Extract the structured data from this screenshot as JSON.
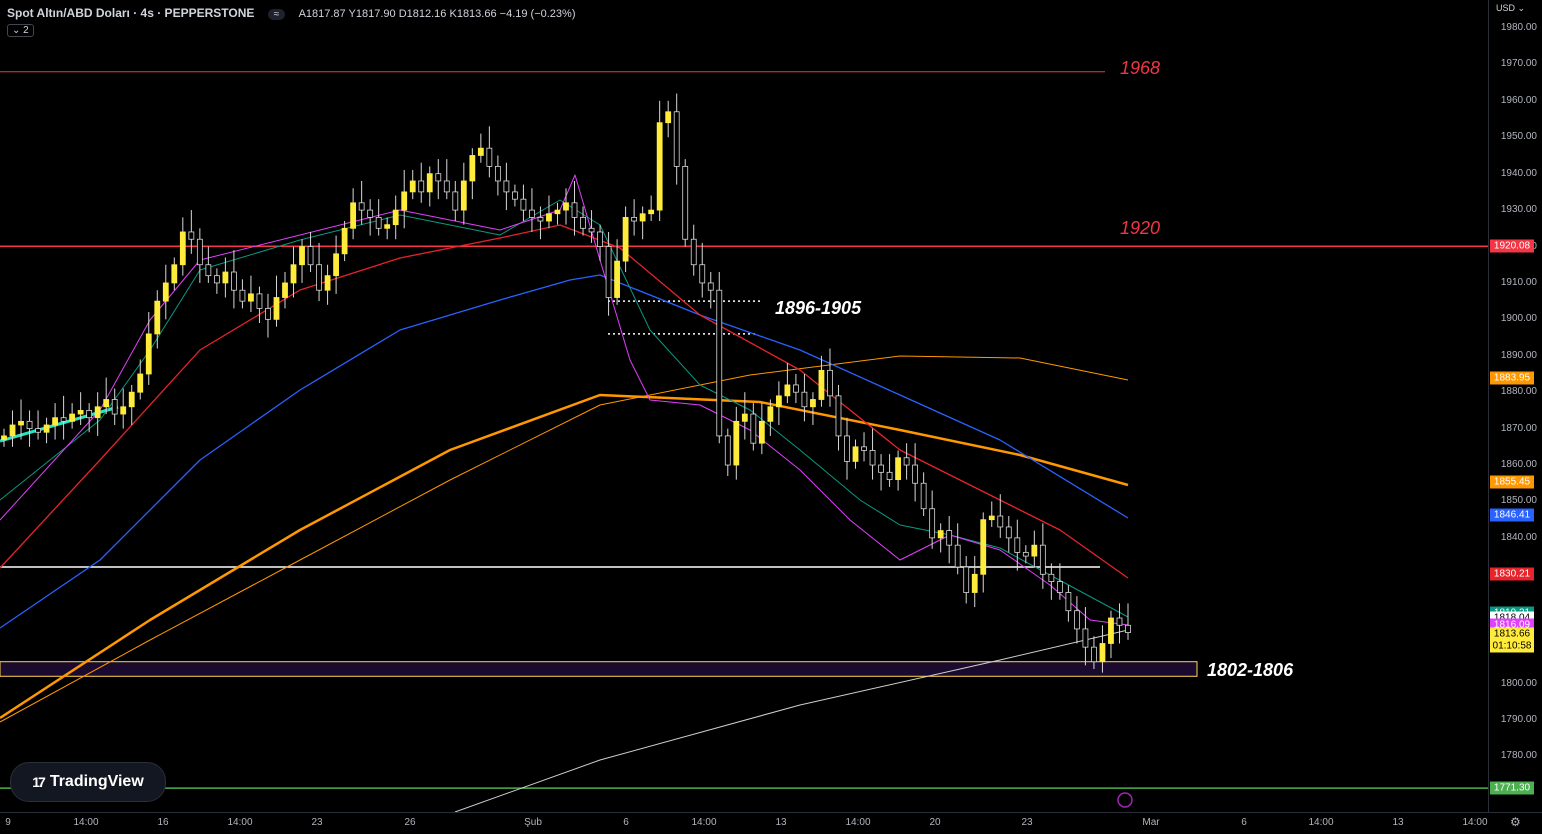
{
  "header": {
    "title": "Spot Altın/ABD Doları · 4s · PEPPERSTONE",
    "status": "≈",
    "ohlc": {
      "open": "A1817.87",
      "high": "Y1817.90",
      "low": "D1812.16",
      "close": "K1813.66",
      "change": "−4.19 (−0.23%)"
    },
    "indicators_toggle": "⌄ 2"
  },
  "currency": "USD ⌄",
  "logo": {
    "mark": "17",
    "text": "TradingView"
  },
  "annotations": {
    "level_1968": "1968",
    "level_1920": "1920",
    "zone_upper": "1896-1905",
    "zone_lower": "1802-1806"
  },
  "price_axis": {
    "ticks": [
      "1980.00",
      "1970.00",
      "1960.00",
      "1950.00",
      "1940.00",
      "1930.00",
      "1920.00",
      "1910.00",
      "1900.00",
      "1890.00",
      "1880.00",
      "1870.00",
      "1860.00",
      "1850.00",
      "1840.00",
      "1800.00",
      "1790.00",
      "1780.00"
    ],
    "labels": [
      {
        "text": "1920.08",
        "color": "#f23645"
      },
      {
        "text": "1883.95",
        "color": "#ff9800"
      },
      {
        "text": "1855.45",
        "color": "#ff9800"
      },
      {
        "text": "1846.41",
        "color": "#2962ff"
      },
      {
        "text": "1830.21",
        "color": "#e5242b"
      },
      {
        "text": "1819.31",
        "color": "#089981"
      },
      {
        "text": "1818.04",
        "color": "#ffffff"
      },
      {
        "text": "1816.09",
        "color": "#e040fb"
      },
      {
        "text": "1813.66",
        "color": "#ffeb3b"
      },
      {
        "text": "01:10:58",
        "color": "#ffeb3b"
      },
      {
        "text": "1771.30",
        "color": "#4caf50"
      }
    ]
  },
  "time_axis": [
    "9",
    "14:00",
    "16",
    "14:00",
    "23",
    "26",
    "Şub",
    "6",
    "14:00",
    "13",
    "14:00",
    "20",
    "23",
    "Mar",
    "6",
    "14:00",
    "13",
    "14:00"
  ],
  "chart_data": {
    "type": "line",
    "symbol": "XAUUSD",
    "ylim": [
      1772,
      1983
    ],
    "candles_close": [
      1868,
      1871,
      1872,
      1870,
      1869,
      1871,
      1873,
      1872,
      1874,
      1875,
      1873,
      1876,
      1878,
      1874,
      1876,
      1880,
      1885,
      1896,
      1905,
      1910,
      1915,
      1924,
      1922,
      1915,
      1912,
      1910,
      1913,
      1908,
      1905,
      1907,
      1903,
      1900,
      1906,
      1910,
      1915,
      1920,
      1915,
      1908,
      1912,
      1918,
      1925,
      1932,
      1930,
      1928,
      1925,
      1926,
      1930,
      1935,
      1938,
      1935,
      1940,
      1938,
      1935,
      1930,
      1938,
      1945,
      1947,
      1942,
      1938,
      1935,
      1933,
      1930,
      1928,
      1927,
      1929,
      1930,
      1932,
      1928,
      1925,
      1924,
      1920,
      1906,
      1916,
      1928,
      1927,
      1929,
      1930,
      1954,
      1957,
      1942,
      1922,
      1915,
      1910,
      1908,
      1868,
      1860,
      1872,
      1874,
      1866,
      1872,
      1876,
      1879,
      1882,
      1880,
      1876,
      1878,
      1886,
      1879,
      1868,
      1861,
      1865,
      1864,
      1860,
      1858,
      1856,
      1862,
      1860,
      1855,
      1848,
      1840,
      1842,
      1838,
      1832,
      1825,
      1830,
      1845,
      1846,
      1843,
      1840,
      1836,
      1835,
      1838,
      1830,
      1828,
      1825,
      1820,
      1815,
      1810,
      1806,
      1811,
      1818,
      1816,
      1814
    ],
    "level_1968": 1968,
    "level_1920": 1920.08,
    "level_1832": 1832,
    "level_1771": 1771.3,
    "zone_upper": [
      1896,
      1905
    ],
    "zone_lower": [
      1802,
      1806
    ]
  }
}
